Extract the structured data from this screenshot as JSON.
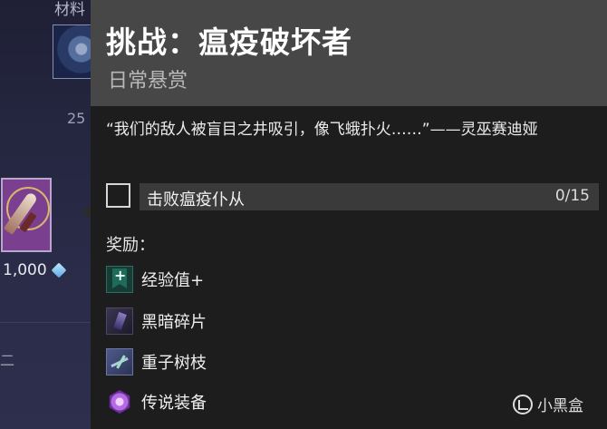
{
  "background": {
    "category_label": "材料",
    "material_count": "25",
    "bounty_cost": "1,000",
    "glyph": "二"
  },
  "tooltip": {
    "title": "挑战：瘟疫破坏者",
    "subtitle": "日常悬赏",
    "quote": "“我们的敌人被盲目之井吸引，像飞蛾扑火……”——灵巫赛迪娅",
    "objective": {
      "label": "击败瘟疫仆从",
      "progress": "0/15",
      "completed": false
    },
    "rewards_label": "奖励：",
    "rewards": [
      {
        "name": "经验值+",
        "icon": "xp-icon"
      },
      {
        "name": "黑暗碎片",
        "icon": "darkness-shard-icon"
      },
      {
        "name": "重子树枝",
        "icon": "baryon-bough-icon"
      },
      {
        "name": "传说装备",
        "icon": "legendary-gear-icon"
      }
    ]
  },
  "watermark": {
    "text": "小黑盒"
  },
  "colors": {
    "header_bg": "#474747",
    "tooltip_bg": "#1d1d1d",
    "objective_bar": "#3a3a3a",
    "bounty_tile": "#7a3f8f"
  }
}
